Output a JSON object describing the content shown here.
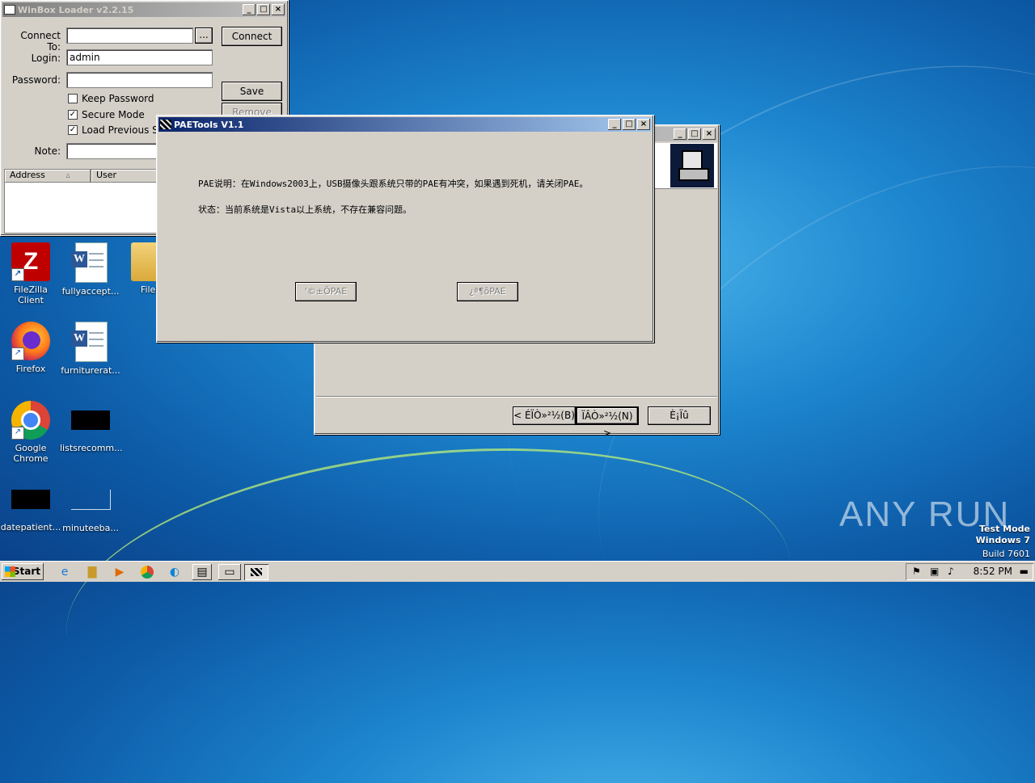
{
  "winbox": {
    "title": "WinBox Loader v2.2.15",
    "connect_to_label": "Connect To:",
    "connect_to_value": "",
    "browse_label": "...",
    "connect_button": "Connect",
    "login_label": "Login:",
    "login_value": "admin",
    "password_label": "Password:",
    "password_value": "",
    "save_button": "Save",
    "remove_button": "Remove",
    "keep_password": {
      "label": "Keep Password",
      "checked": false
    },
    "secure_mode": {
      "label": "Secure Mode",
      "checked": true
    },
    "load_previous": {
      "label": "Load Previous Sess",
      "checked": true
    },
    "note_label": "Note:",
    "note_value": "",
    "columns": [
      "Address",
      "User"
    ]
  },
  "installer": {
    "back_button": "< ÉÏÒ»²½(B)",
    "next_button": "ÏÂÒ»²½(N) >",
    "cancel_button": "È¡Ïû"
  },
  "paetools": {
    "title": "PAETools V1.1",
    "description": "PAE说明：在Windows2003上，USB摄像头跟系统只带的PAE有冲突，如果遇到死机，请关闭PAE。",
    "status": "状态：当前系统是Vista以上系统，不存在兼容问题。",
    "enable_button": "'©±ÕPAE",
    "disable_button": "¿ª¶ôPAE"
  },
  "desktop_icons": [
    {
      "label": "FileZilla Client",
      "icon": "filezilla-icon"
    },
    {
      "label": "fullyaccept...",
      "icon": "word-document-icon"
    },
    {
      "label": "Files",
      "icon": "folder-icon"
    },
    {
      "label": "Firefox",
      "icon": "firefox-icon"
    },
    {
      "label": "furniturerat...",
      "icon": "word-document-icon"
    },
    {
      "label": "Google Chrome",
      "icon": "chrome-icon"
    },
    {
      "label": "listsrecomm...",
      "icon": "black-file-icon"
    },
    {
      "label": "datepatient...",
      "icon": "black-file-icon"
    },
    {
      "label": "minuteeba...",
      "icon": "blank-file-icon"
    }
  ],
  "watermark": {
    "brand": "ANY RUN",
    "test_mode": "Test Mode",
    "os": "Windows 7",
    "build": "Build 7601"
  },
  "taskbar": {
    "start_label": "Start",
    "clock": "8:52 PM"
  }
}
